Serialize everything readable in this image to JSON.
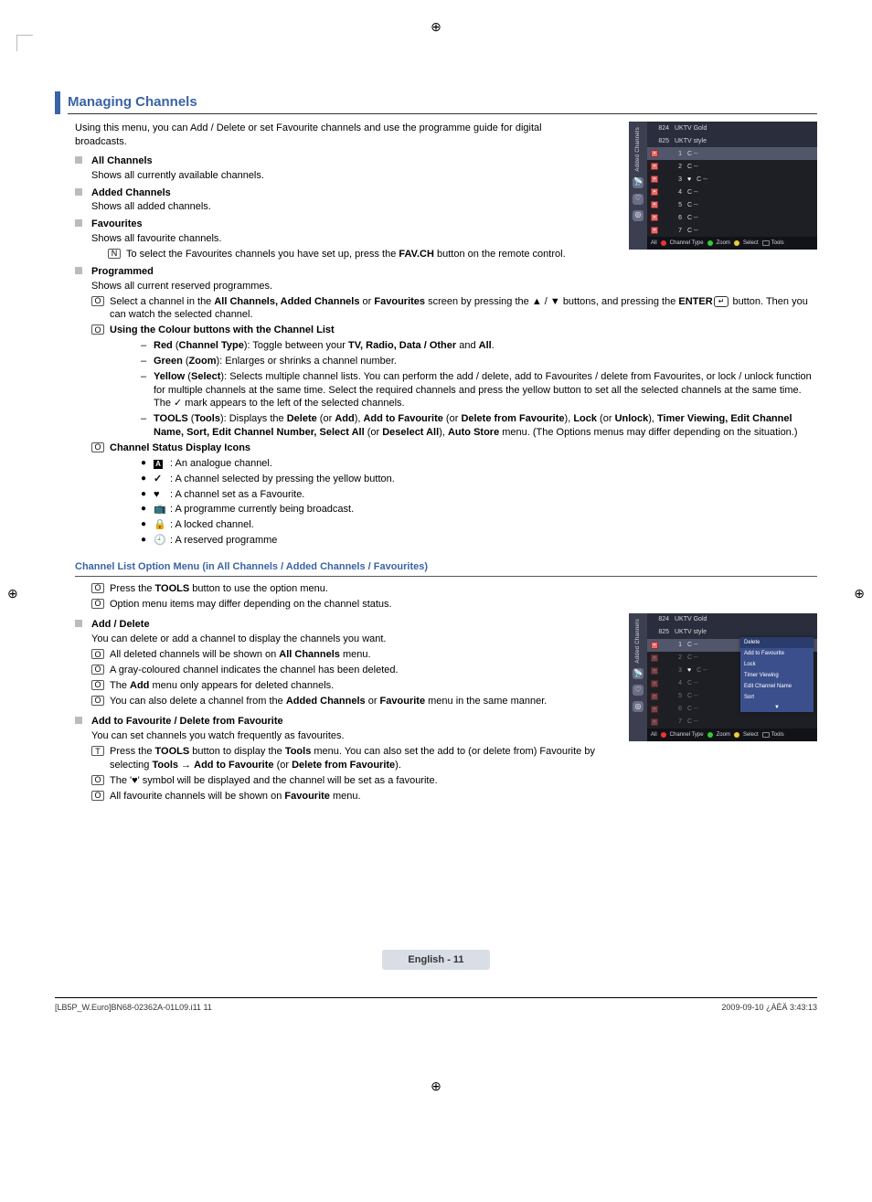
{
  "print_marks": {
    "reg": "⊕"
  },
  "section_title": "Managing Channels",
  "intro": "Using this menu, you can Add / Delete or set Favourite channels and use the programme guide for digital broadcasts.",
  "subs": {
    "all_channels": {
      "title": "All Channels",
      "desc": "Shows all currently available channels."
    },
    "added_channels": {
      "title": "Added Channels",
      "desc": "Shows all added channels."
    },
    "favourites": {
      "title": "Favourites",
      "desc": "Shows all favourite channels."
    },
    "programmed": {
      "title": "Programmed",
      "desc": "Shows all current reserved programmes."
    }
  },
  "notes": {
    "fav_select_pre": "To select the Favourites channels you have set up, press the ",
    "fav_select_btn": "FAV.CH",
    "fav_select_post": " button on the remote control.",
    "select_channel_pre": "Select a channel in the ",
    "select_channel_bold1": "All Channels, Added Channels",
    "select_channel_mid1": " or ",
    "select_channel_bold2": "Favourites",
    "select_channel_mid2": " screen by pressing the ▲ / ▼ buttons, and pressing the ",
    "select_channel_bold3": "ENTER",
    "select_channel_enter_icon": "↵",
    "select_channel_post": " button. Then you can watch the selected channel.",
    "colour_title": "Using the Colour buttons with the Channel List",
    "dashes": {
      "red_bold1": "Red",
      "red_paren1": "Channel Type",
      "red_mid": ": Toggle between your ",
      "red_bold2": "TV, Radio, Data / Other",
      "red_mid2": " and ",
      "red_bold3": "All",
      "red_post": ".",
      "green_bold1": "Green",
      "green_paren1": "Zoom",
      "green_post": ": Enlarges or shrinks a channel number.",
      "yellow_bold1": "Yellow",
      "yellow_paren1": "Select",
      "yellow_body": ": Selects multiple channel lists. You can perform the add / delete, add to Favourites / delete from Favourites, or lock / unlock function for multiple channels at the same time. Select the required channels and press the yellow button to set all the selected channels at the same time. The ✓ mark appears to the left of the selected channels.",
      "tools_bold1": "TOOLS",
      "tools_paren1": "Tools",
      "tools_mid1": ": Displays the ",
      "tools_bold2": "Delete",
      "tools_mid2": " (or ",
      "tools_bold3": "Add",
      "tools_mid3": "), ",
      "tools_bold4": "Add to Favourite",
      "tools_mid4": " (or ",
      "tools_bold5": "Delete from Favourite",
      "tools_mid5": "), ",
      "tools_bold6": "Lock",
      "tools_mid6": " (or ",
      "tools_bold7": "Unlock",
      "tools_mid7": "), ",
      "tools_bold8": "Timer Viewing, Edit Channel Name, Sort, Edit Channel Number, Select All",
      "tools_mid8": " (or ",
      "tools_bold9": "Deselect All",
      "tools_mid9": "), ",
      "tools_bold10": "Auto Store",
      "tools_post": " menu. (The Options menus may differ depending on the situation.)"
    },
    "status_title": "Channel Status Display Icons",
    "status_items": {
      "a": ": An analogue channel.",
      "check": ": A channel selected by pressing the yellow button.",
      "heart": ": A channel set as a Favourite.",
      "tv": ": A programme currently being broadcast.",
      "lock": ": A locked channel.",
      "clock": ": A reserved programme"
    }
  },
  "option_heading": "Channel List Option Menu (in All Channels / Added Channels / Favourites)",
  "option_notes": {
    "press_pre": "Press the ",
    "press_bold": "TOOLS",
    "press_post": " button to use the option menu.",
    "differ": "Option menu items may differ depending on the channel status."
  },
  "add_delete": {
    "title": "Add / Delete",
    "desc": "You can delete or add a channel to display the channels you want.",
    "n1_pre": "All deleted channels will be shown on ",
    "n1_bold": "All Channels",
    "n1_post": " menu.",
    "n2": "A gray-coloured channel indicates the channel has been deleted.",
    "n3_pre": "The ",
    "n3_bold": "Add",
    "n3_post": " menu only appears for deleted channels.",
    "n4_pre": "You can also delete a channel from the ",
    "n4_bold1": "Added Channels",
    "n4_mid": " or ",
    "n4_bold2": "Favourite",
    "n4_post": " menu in the same manner."
  },
  "add_fav": {
    "title": "Add to Favourite / Delete from Favourite",
    "desc": "You can set channels you watch frequently as favourites.",
    "o1_pre": "Press the ",
    "o1_bold1": "TOOLS",
    "o1_mid1": " button to display the ",
    "o1_bold2": "Tools",
    "o1_mid2": " menu. You can also set the add to (or delete from) Favourite by selecting ",
    "o1_bold3": "Tools",
    "o1_mid3": " → ",
    "o1_bold4": "Add to Favourite",
    "o1_mid4": " (or ",
    "o1_bold5": "Delete from Favourite",
    "o1_post": ").",
    "o2": "The '♥' symbol will be displayed and the channel will be set as a favourite.",
    "o3_pre": "All favourite channels will be shown on ",
    "o3_bold": "Favourite",
    "o3_post": " menu."
  },
  "icons": {
    "n": "N",
    "o": "O",
    "t": "T",
    "heart": "♥",
    "check": "✓",
    "lock": "🔒",
    "clock": "🕘",
    "tv": "📺",
    "a_glyph": "A",
    "arrow": "▼"
  },
  "screen1": {
    "side_label": "Added Channels",
    "headers": [
      {
        "num": "824",
        "name": "UKTV Gold"
      },
      {
        "num": "825",
        "name": "UKTV style"
      }
    ],
    "rows": [
      {
        "num": "1",
        "name": "C --",
        "sel": true,
        "heart": false
      },
      {
        "num": "2",
        "name": "C --"
      },
      {
        "num": "3",
        "name": "C --",
        "heart": true
      },
      {
        "num": "4",
        "name": "C --"
      },
      {
        "num": "5",
        "name": "C --"
      },
      {
        "num": "6",
        "name": "C --"
      },
      {
        "num": "7",
        "name": "C --"
      }
    ],
    "footer": {
      "all": "All",
      "ct": "Channel Type",
      "zoom": "Zoom",
      "select": "Select",
      "tools": "Tools"
    }
  },
  "screen2": {
    "side_label": "Added Channels",
    "headers": [
      {
        "num": "824",
        "name": "UKTV Gold"
      },
      {
        "num": "825",
        "name": "UKTV style"
      }
    ],
    "rows": [
      {
        "num": "1",
        "name": "C --",
        "sel": true
      },
      {
        "num": "2",
        "name": "C --"
      },
      {
        "num": "3",
        "name": "C --",
        "heart": true
      },
      {
        "num": "4",
        "name": "C --"
      },
      {
        "num": "5",
        "name": "C --"
      },
      {
        "num": "6",
        "name": "C --"
      },
      {
        "num": "7",
        "name": "C --"
      }
    ],
    "footer": {
      "all": "All",
      "ct": "Channel Type",
      "zoom": "Zoom",
      "select": "Select",
      "tools": "Tools"
    },
    "popup": [
      "Delete",
      "Add to Favourite",
      "Lock",
      "Timer Viewing",
      "Edit Channel Name",
      "Sort"
    ]
  },
  "footer": {
    "lang": "English - 11",
    "left": "[LB5P_W.Euro]BN68-02362A-01L09.i11   11",
    "right": "2009-09-10   ¿ÀÈÄ 3:43:13"
  }
}
